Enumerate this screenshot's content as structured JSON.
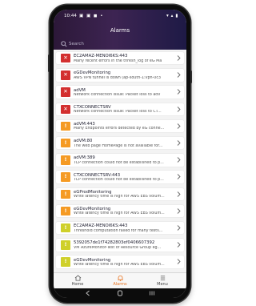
{
  "status": {
    "time": "10:44",
    "left_icons": "▣ ▣ ◼ •",
    "right_icons": "▾ ▴ ▮"
  },
  "header": {
    "title": "Alarms",
    "search_placeholder": "Search"
  },
  "alarms": [
    {
      "title": "EC2AMAZ-MENOI6KS:443",
      "desc": "Many recent errors in the thresh_log of eG Ma",
      "severity": "critical",
      "mark": "✕"
    },
    {
      "title": "eGDevMonitoring",
      "desc": "AWS VPN tunnel is down (ap-south-1:vpn-0c3",
      "severity": "critical",
      "mark": "✕"
    },
    {
      "title": "adVM",
      "desc": "Network connection issue: Packet loss to adV",
      "severity": "critical",
      "mark": "✕"
    },
    {
      "title": "CTXCONNECTSRV",
      "desc": "Network connection issue: Packet loss to CT...",
      "severity": "critical",
      "mark": "✕"
    },
    {
      "title": "adVM:443",
      "desc": "Many Endpoints errors detected by eG conne...",
      "severity": "major",
      "mark": "!"
    },
    {
      "title": "adVM:80",
      "desc": "The web page HomePage is not available for...",
      "severity": "major",
      "mark": "!"
    },
    {
      "title": "adVM:389",
      "desc": "TCP connection could not be established to p...",
      "severity": "major",
      "mark": "!"
    },
    {
      "title": "CTXCONNECTSRV:443",
      "desc": "TCP connection could not be established to p...",
      "severity": "major",
      "mark": "!"
    },
    {
      "title": "eGProdMonitoring",
      "desc": "Write latency time is high for AWS EBS volum...",
      "severity": "major",
      "mark": "!"
    },
    {
      "title": "eGDevMonitoring",
      "desc": "Write latency time is high for AWS EBS volum...",
      "severity": "major",
      "mark": "!"
    },
    {
      "title": "EC2AMAZ-MENOI6KS:443",
      "desc": "Threshold computation failed for many tests...",
      "severity": "minor",
      "mark": "!"
    },
    {
      "title": "5392057de1f74282803ef0406607392",
      "desc": "VM AzureMonitor-Test of Resource Group eg...",
      "severity": "minor",
      "mark": "!"
    },
    {
      "title": "eGDevMonitoring",
      "desc": "Write latency time is high for AWS EBS volum...",
      "severity": "minor",
      "mark": "!"
    }
  ],
  "tabs": [
    {
      "label": "Home",
      "icon": "home-icon"
    },
    {
      "label": "Alarms",
      "icon": "bell-icon",
      "active": true
    },
    {
      "label": "Menu",
      "icon": "menu-icon"
    }
  ],
  "colors": {
    "critical": "#d32f2f",
    "major": "#f59a23",
    "minor": "#cfd02a",
    "accent": "#e8721e",
    "header_start": "#2c1838",
    "header_end": "#1e1a46"
  }
}
